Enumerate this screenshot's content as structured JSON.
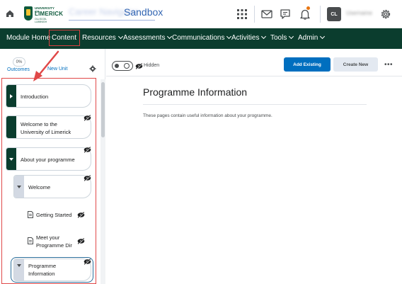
{
  "topbar": {
    "logo": {
      "line1": "UNIVERSITY OF",
      "line2": "LIMERICK",
      "line3": "OLLSCOIL LUIMNIGH"
    },
    "org_prefix_blurred": "Career Navigator",
    "org_title": "Sandbox",
    "avatar_initials": "CL",
    "username_blurred": "Username",
    "accent_color": "#e87511"
  },
  "navbar": {
    "items": [
      {
        "label": "Module Home",
        "has_menu": false
      },
      {
        "label": "Content",
        "has_menu": false
      },
      {
        "label": "Resources",
        "has_menu": true
      },
      {
        "label": "Assessments",
        "has_menu": true
      },
      {
        "label": "Communications",
        "has_menu": true
      },
      {
        "label": "Activities",
        "has_menu": true
      },
      {
        "label": "Tools",
        "has_menu": true
      },
      {
        "label": "Admin",
        "has_menu": true
      }
    ],
    "background_color": "#0b3d2e"
  },
  "left_panel": {
    "outcomes_percent": "0%",
    "outcomes_label": "Outcomes",
    "new_unit_label": "New Unit",
    "toc": [
      {
        "label": "Introduction",
        "level": 0,
        "expanded": false,
        "hidden": false
      },
      {
        "label": "Welcome to the University of Limerick",
        "level": 0,
        "expanded": false,
        "hidden": true
      },
      {
        "label": "About your programme",
        "level": 0,
        "expanded": true,
        "hidden": true
      },
      {
        "label": "Welcome",
        "level": 1,
        "expanded": true,
        "hidden": true
      },
      {
        "label": "Getting Started",
        "level": 2,
        "type": "page",
        "hidden": true
      },
      {
        "label": "Meet your Programme Dir",
        "level": 2,
        "type": "page",
        "hidden": true
      },
      {
        "label": "Programme Information",
        "level": 1,
        "expanded": true,
        "hidden": true,
        "selected": true
      }
    ]
  },
  "main": {
    "visibility_label": "Hidden",
    "add_existing_label": "Add Existing",
    "create_new_label": "Create New",
    "more_label": "•••",
    "page_title": "Programme Information",
    "page_description": "These pages contain useful information about your programme.",
    "primary_color": "#006fbf"
  }
}
